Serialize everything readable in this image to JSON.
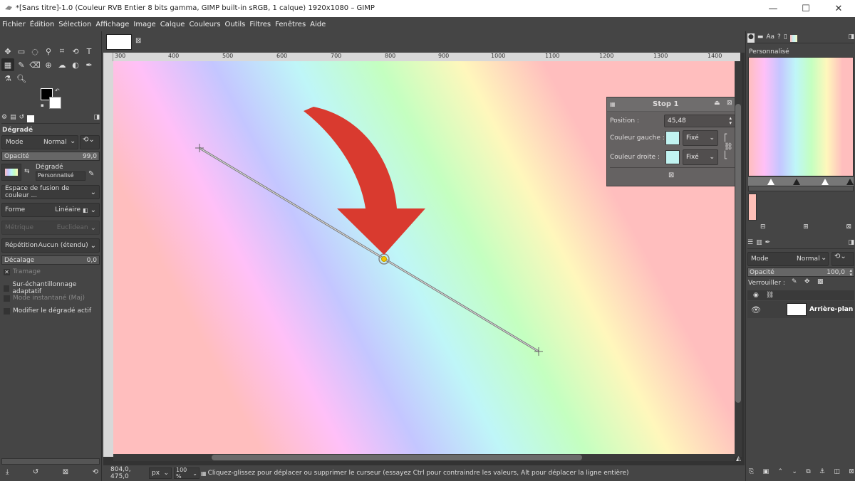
{
  "window": {
    "title": "*[Sans titre]-1.0 (Couleur RVB Entier 8 bits gamma, GIMP built-in sRGB, 1 calque) 1920x1080 – GIMP"
  },
  "menu": [
    "Fichier",
    "Édition",
    "Sélection",
    "Affichage",
    "Image",
    "Calque",
    "Couleurs",
    "Outils",
    "Filtres",
    "Fenêtres",
    "Aide"
  ],
  "tool_options": {
    "title": "Dégradé",
    "mode_label": "Mode",
    "mode_value": "Normal",
    "opacity_label": "Opacité",
    "opacity_value": "99,0",
    "gradient_label": "Dégradé",
    "gradient_value": "Personnalisé",
    "blend_space": "Espace de fusion de couleur ...",
    "shape_label": "Forme",
    "shape_value": "Linéaire",
    "metric_label": "Métrique",
    "metric_value": "Euclidean",
    "repeat_label": "Répétition",
    "repeat_value": "Aucun (étendu)",
    "offset_label": "Décalage",
    "offset_value": "0,0",
    "dither": "Tramage",
    "supersample": "Sur-échantillonnage adaptatif",
    "instant": "Mode instantané (Maj)",
    "modify_active": "Modifier le dégradé actif"
  },
  "ruler_h": [
    "300",
    "400",
    "500",
    "600",
    "700",
    "800",
    "900",
    "1000",
    "1100",
    "1200",
    "1300",
    "1400"
  ],
  "stop_dialog": {
    "title": "Stop 1",
    "position_label": "Position :",
    "position_value": "45,48",
    "left_color_label": "Couleur gauche :",
    "left_type": "Fixé",
    "right_color_label": "Couleur droite :",
    "right_type": "Fixé"
  },
  "status": {
    "coords": "804,0, 475,0",
    "unit": "px",
    "zoom": "100 %",
    "message": "Cliquez-glissez pour déplacer ou supprimer le curseur (essayez Ctrl pour contraindre les valeurs, Alt pour déplacer la ligne entière)"
  },
  "right_panel": {
    "gradient_name": "Personnalisé",
    "mode_label": "Mode",
    "mode_value": "Normal",
    "opacity_label": "Opacité",
    "opacity_value": "100,0",
    "lock_label": "Verrouiller :",
    "layer_name": "Arrière-plan"
  },
  "colors": {
    "arrow": "#d93a2f",
    "swatch": "#bff6f4"
  }
}
